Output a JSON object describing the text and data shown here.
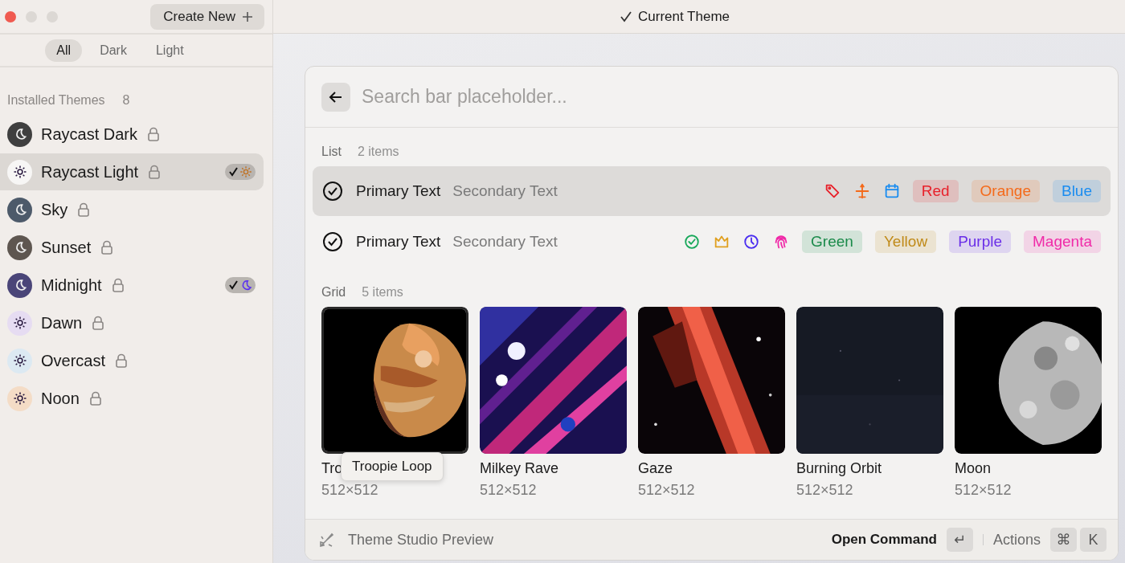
{
  "sidebar": {
    "create_button": {
      "label": "Create New"
    },
    "filters": [
      {
        "label": "All",
        "selected": true
      },
      {
        "label": "Dark",
        "selected": false
      },
      {
        "label": "Light",
        "selected": false
      }
    ],
    "section": {
      "title": "Installed Themes",
      "count": "8"
    },
    "themes": [
      {
        "name": "Raycast Dark",
        "kind": "dark",
        "color": "#3f3f3f",
        "locked": true,
        "selected": false
      },
      {
        "name": "Raycast Light",
        "kind": "light",
        "color": "#f7f6f5",
        "locked": true,
        "selected": true,
        "is_default": true
      },
      {
        "name": "Sky",
        "kind": "dark",
        "color": "#4d5a6a",
        "locked": true,
        "selected": false
      },
      {
        "name": "Sunset",
        "kind": "dark",
        "color": "#5e5650",
        "locked": true,
        "selected": false
      },
      {
        "name": "Midnight",
        "kind": "dark",
        "color": "#4a4578",
        "locked": true,
        "selected": false,
        "is_default": true
      },
      {
        "name": "Dawn",
        "kind": "light",
        "color": "#e6dcf2",
        "locked": true,
        "selected": false
      },
      {
        "name": "Overcast",
        "kind": "light",
        "color": "#dce9f2",
        "locked": true,
        "selected": false
      },
      {
        "name": "Noon",
        "kind": "light",
        "color": "#f4dcc6",
        "locked": true,
        "selected": false
      }
    ]
  },
  "header": {
    "title": "Current Theme"
  },
  "window": {
    "search": {
      "placeholder": "Search bar placeholder..."
    },
    "list": {
      "title": "List",
      "count": "2 items",
      "items": [
        {
          "primary": "Primary Text",
          "secondary": "Secondary Text",
          "selected": true,
          "icons": [
            {
              "kind": "tag",
              "color": "#e8202a"
            },
            {
              "kind": "plane",
              "color": "#f46a1a"
            },
            {
              "kind": "calendar",
              "color": "#1a8cf0"
            }
          ],
          "tags": [
            {
              "text": "Red",
              "color": "#e8202a"
            },
            {
              "text": "Orange",
              "color": "#f46a1a"
            },
            {
              "text": "Blue",
              "color": "#1a8cf0"
            }
          ]
        },
        {
          "primary": "Primary Text",
          "secondary": "Secondary Text",
          "selected": false,
          "icons": [
            {
              "kind": "check",
              "color": "#18a85a"
            },
            {
              "kind": "crown",
              "color": "#e0a020"
            },
            {
              "kind": "clock",
              "color": "#4a2ef0"
            },
            {
              "kind": "fingerprint",
              "color": "#f02aa8"
            }
          ],
          "tags": [
            {
              "text": "Green",
              "color": "#1a8a4a"
            },
            {
              "text": "Yellow",
              "color": "#c08a18"
            },
            {
              "text": "Purple",
              "color": "#6a2ee8"
            },
            {
              "text": "Magenta",
              "color": "#f02aa8"
            }
          ]
        }
      ]
    },
    "grid": {
      "title": "Grid",
      "count": "5 items",
      "items": [
        {
          "title": "Tro",
          "subtitle": "512×512",
          "selected": true
        },
        {
          "title": "Milkey Rave",
          "subtitle": "512×512",
          "selected": false
        },
        {
          "title": "Gaze",
          "subtitle": "512×512",
          "selected": false
        },
        {
          "title": "Burning Orbit",
          "subtitle": "512×512",
          "selected": false
        },
        {
          "title": "Moon",
          "subtitle": "512×512",
          "selected": false
        }
      ],
      "tooltip": {
        "text": "Troopie Loop"
      }
    },
    "footer": {
      "title": "Theme Studio Preview",
      "primary_action": "Open Command",
      "primary_key": "↵",
      "actions_label": "Actions",
      "action_keys": [
        "⌘",
        "K"
      ]
    }
  }
}
